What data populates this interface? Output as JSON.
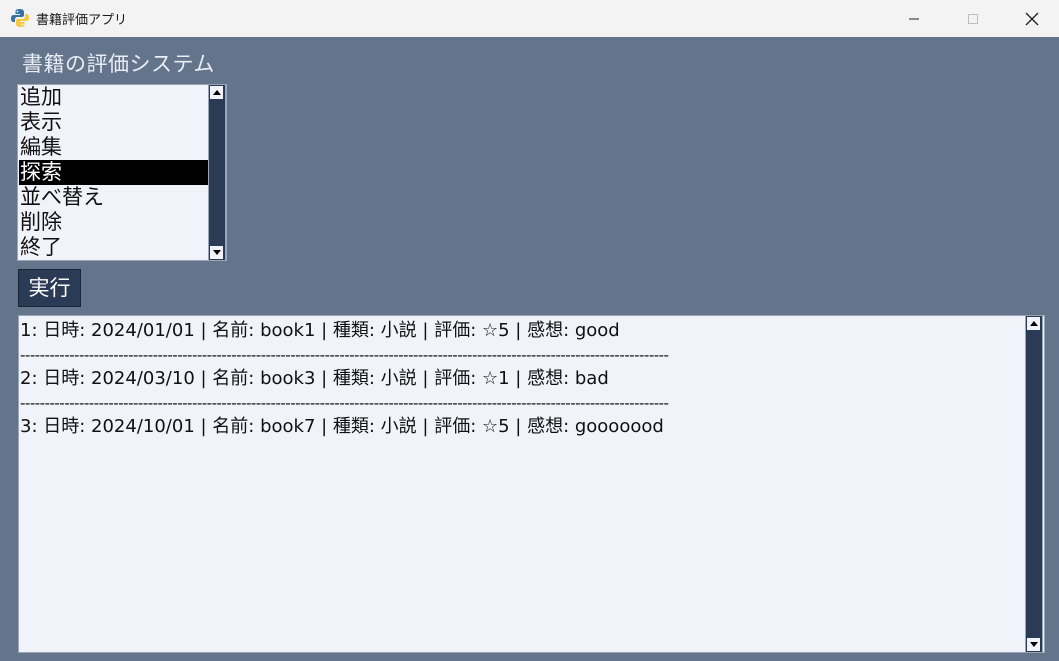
{
  "window": {
    "title": "書籍評価アプリ",
    "minimize_glyph": "—",
    "maximize_glyph": "☐",
    "close_glyph": "✕"
  },
  "heading": "書籍の評価システム",
  "menu": {
    "items": [
      {
        "label": "追加"
      },
      {
        "label": "表示"
      },
      {
        "label": "編集"
      },
      {
        "label": "探索"
      },
      {
        "label": "並べ替え"
      },
      {
        "label": "削除"
      },
      {
        "label": "終了"
      }
    ],
    "selected_label": "探索"
  },
  "run_button": "実行",
  "output": {
    "lines": [
      "1: 日時: 2024/01/01 | 名前: book1 | 種類: 小説 | 評価: ☆5 | 感想: good",
      "------------------------------------------------------------------------------------------------------------------------------------",
      "2: 日時: 2024/03/10 | 名前: book3 | 種類: 小説 | 評価: ☆1 | 感想: bad",
      "------------------------------------------------------------------------------------------------------------------------------------",
      "3: 日時: 2024/10/01 | 名前: book7 | 種類: 小説 | 評価: ☆5 | 感想: gooooood"
    ]
  },
  "colors": {
    "background": "#64758b",
    "panel": "#f0f3f9",
    "accent": "#2b3a55",
    "selection": "#000000"
  },
  "icons": {
    "app": "python-icon",
    "minimize": "minimize-icon",
    "maximize": "maximize-icon",
    "close": "close-icon"
  }
}
